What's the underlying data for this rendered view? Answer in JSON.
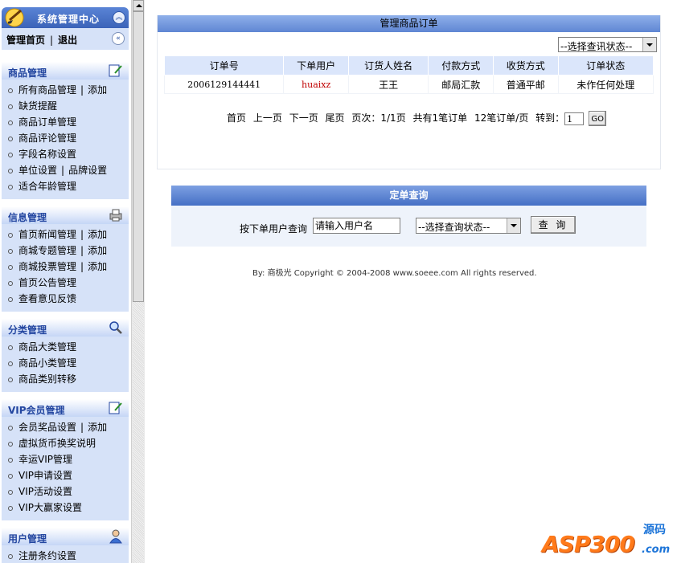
{
  "sidebar": {
    "title": "系统管理中心",
    "home_link": "管理首页",
    "separator": "|",
    "logout_link": "退出",
    "groups": [
      {
        "title": "商品管理",
        "icon": "edit-note-icon",
        "items": [
          {
            "label": "所有商品管理",
            "extra": "添加"
          },
          {
            "label": "缺货提醒"
          },
          {
            "label": "商品订单管理"
          },
          {
            "label": "商品评论管理"
          },
          {
            "label": "字段名称设置"
          },
          {
            "label": "单位设置",
            "extra": "品牌设置"
          },
          {
            "label": "适合年龄管理"
          }
        ]
      },
      {
        "title": "信息管理",
        "icon": "printer-icon",
        "items": [
          {
            "label": "首页新闻管理",
            "extra": "添加"
          },
          {
            "label": "商城专题管理",
            "extra": "添加"
          },
          {
            "label": "商城投票管理",
            "extra": "添加"
          },
          {
            "label": "首页公告管理"
          },
          {
            "label": "查看意见反馈"
          }
        ]
      },
      {
        "title": "分类管理",
        "icon": "magnifier-icon",
        "items": [
          {
            "label": "商品大类管理"
          },
          {
            "label": "商品小类管理"
          },
          {
            "label": "商品类别转移"
          }
        ]
      },
      {
        "title": "VIP会员管理",
        "icon": "edit-note-icon",
        "items": [
          {
            "label": "会员奖品设置",
            "extra": "添加"
          },
          {
            "label": "虚拟货币换奖说明"
          },
          {
            "label": "幸运VIP管理"
          },
          {
            "label": "VIP申请设置"
          },
          {
            "label": "VIP活动设置"
          },
          {
            "label": "VIP大赢家设置"
          }
        ]
      },
      {
        "title": "用户管理",
        "icon": "user-icon",
        "items": [
          {
            "label": "注册条约设置"
          }
        ]
      }
    ]
  },
  "orders_panel": {
    "title": "管理商品订单",
    "status_filter": "--选择查讯状态--",
    "columns": [
      "订单号",
      "下单用户",
      "订货人姓名",
      "付款方式",
      "收货方式",
      "订单状态"
    ],
    "rows": [
      [
        "2006129144441",
        "huaixz",
        "王王",
        "邮局汇款",
        "普通平邮",
        "未作任何处理"
      ]
    ],
    "pager": {
      "first": "首页",
      "prev": "上一页",
      "next": "下一页",
      "last": "尾页",
      "page_info": "页次：1/1页",
      "total_info": "共有1笔订单",
      "per_page": "12笔订单/页",
      "goto_label": "转到：",
      "goto_value": "1",
      "go_button": "GO"
    }
  },
  "query_panel": {
    "title": "定单查询",
    "label": "按下单用户查询",
    "input_value": "请输入用户名",
    "status_select": "--选择查询状态--",
    "button": "查 询"
  },
  "footer": {
    "copyright": "By: 商极光 Copyright © 2004-2008 www.soeee.com All rights reserved."
  },
  "watermark": {
    "main": "ASP300",
    "cn": "源码",
    "domain": ".com"
  },
  "colors": {
    "header_blue": "#4f77c9",
    "sidebar_bg": "#d6e2f8",
    "group_title": "#2346a0",
    "user_red": "#c00000",
    "watermark_orange": "#ff7a1a"
  }
}
